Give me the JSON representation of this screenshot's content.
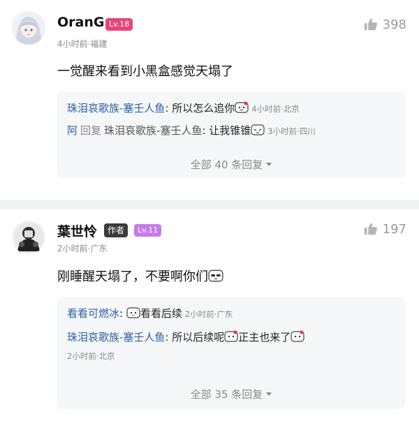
{
  "comments": [
    {
      "author": "OranG",
      "level": "Lv.18",
      "meta": "4小时前·福建",
      "likes": "398",
      "content": "一觉醒来看到小黑盒感觉天塌了",
      "replies": [
        {
          "author": "珠泪哀歌族-塞壬人鱼",
          "text": "所以怎么追你",
          "time": "4小时前·北京"
        },
        {
          "author": "阿",
          "verb": "回复",
          "target": "珠泪哀歌族-塞壬人鱼",
          "text": "让我锥锥",
          "time": "3小时前·四川"
        }
      ],
      "more": "全部 40 条回复"
    },
    {
      "author": "葉世怜",
      "author_tag": "作者",
      "level": "Lv.11",
      "meta": "2小时前·广东",
      "likes": "197",
      "content": "刚睡醒天塌了，不要啊你们",
      "replies": [
        {
          "author": "看看可燃冰",
          "text": "看看后续",
          "time": "2小时前·广东"
        },
        {
          "author": "珠泪哀歌族-塞壬人鱼",
          "text": "所以后续呢",
          "text2": "正主也来了",
          "time": "2小时前·北京"
        }
      ],
      "more": "全部 35 条回复"
    }
  ],
  "colors": {
    "level_18": "#e8437a",
    "level_11": "#c47be8",
    "reply_author": "#2d5ea3",
    "meta": "#8a8a8a"
  },
  "icons": {
    "like": "thumbs-up-icon",
    "emoji": "sticker-emoji-icon",
    "expand": "chevron-down-icon"
  }
}
